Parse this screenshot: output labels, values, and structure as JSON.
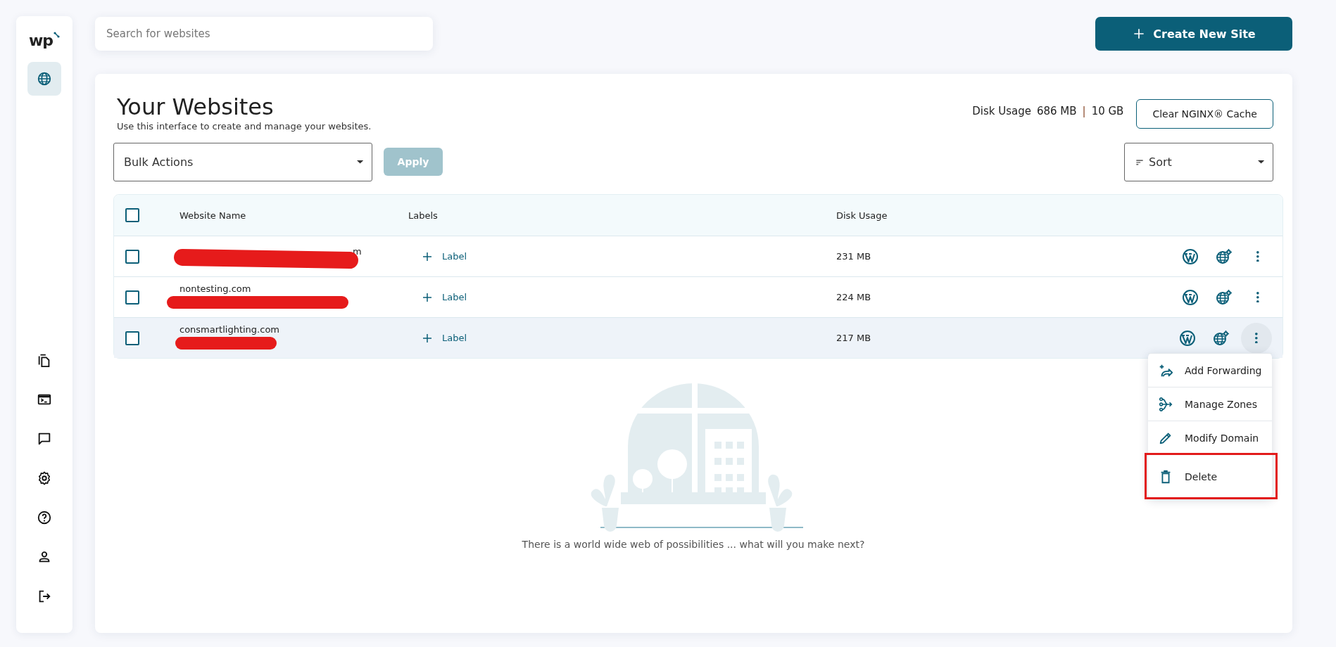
{
  "sidebar": {
    "logo": "wp",
    "top_items": [
      {
        "kind": "globe",
        "selected": true
      }
    ],
    "bottom_items": [
      {
        "kind": "copy",
        "selected": false
      },
      {
        "kind": "terminal",
        "selected": false
      },
      {
        "kind": "chat",
        "selected": false
      },
      {
        "kind": "gear",
        "selected": false
      },
      {
        "kind": "help",
        "selected": false
      },
      {
        "kind": "user",
        "selected": false
      },
      {
        "kind": "logout",
        "selected": false
      }
    ]
  },
  "search": {
    "placeholder": "Search for websites"
  },
  "create_button": {
    "label": "Create New Site"
  },
  "page": {
    "title": "Your Websites",
    "subtitle": "Use this interface to create and manage your websites.",
    "disk_usage": {
      "label": "Disk Usage",
      "used": "686 MB",
      "separator": "|",
      "total": "10 GB"
    },
    "clear_cache_button": "Clear NGINX® Cache",
    "bulk_actions": {
      "value": "Bulk Actions"
    },
    "apply_button": {
      "label": "Apply",
      "disabled": true
    },
    "sort": {
      "value": "Sort"
    }
  },
  "table": {
    "columns": [
      "Website Name",
      "Labels",
      "Disk Usage"
    ],
    "all_checked": false,
    "rows": [
      {
        "name": "m",
        "kind": "trailing",
        "checked": false,
        "label_button": "Label",
        "disk_usage": "231 MB",
        "highlighted": false,
        "menu_open": false
      },
      {
        "name": "nontesting.com",
        "kind": "stacked",
        "checked": false,
        "label_button": "Label",
        "disk_usage": "224 MB",
        "highlighted": false,
        "menu_open": false
      },
      {
        "name": "consmartlighting.com",
        "kind": "stacked",
        "checked": false,
        "label_button": "Label",
        "disk_usage": "217 MB",
        "highlighted": true,
        "menu_open": true
      }
    ]
  },
  "row_menu": {
    "items": [
      {
        "kind": "forward",
        "label": "Add Forwarding",
        "highlighted": false
      },
      {
        "kind": "zones",
        "label": "Manage Zones",
        "highlighted": false
      },
      {
        "kind": "pencil",
        "label": "Modify Domain",
        "highlighted": false
      },
      {
        "kind": "trash",
        "label": "Delete",
        "highlighted": true
      }
    ]
  },
  "empty_state": {
    "message": "There is a world wide web of possibilities ... what will you make next?"
  }
}
